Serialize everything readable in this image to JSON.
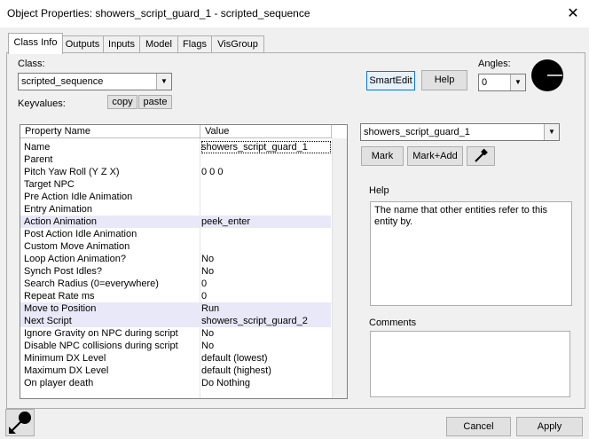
{
  "window": {
    "title": "Object Properties: showers_script_guard_1 - scripted_sequence",
    "close_glyph": "✕"
  },
  "tabs": [
    "Class Info",
    "Outputs",
    "Inputs",
    "Model",
    "Flags",
    "VisGroup"
  ],
  "class_section": {
    "class_label": "Class:",
    "class_value": "scripted_sequence",
    "keyvalues_label": "Keyvalues:",
    "copy_label": "copy",
    "paste_label": "paste",
    "smartedit_label": "SmartEdit",
    "help_label": "Help",
    "angles_label": "Angles:",
    "angles_value": "0"
  },
  "grid": {
    "columns": [
      "Property Name",
      "Value"
    ],
    "rows": [
      {
        "name": "Name",
        "value": "showers_script_guard_1"
      },
      {
        "name": "Parent",
        "value": ""
      },
      {
        "name": "Pitch Yaw Roll (Y Z X)",
        "value": "0 0 0"
      },
      {
        "name": "Target NPC",
        "value": ""
      },
      {
        "name": "Pre Action Idle Animation",
        "value": ""
      },
      {
        "name": "Entry Animation",
        "value": ""
      },
      {
        "name": "Action Animation",
        "value": "peek_enter"
      },
      {
        "name": "Post Action Idle Animation",
        "value": ""
      },
      {
        "name": "Custom Move Animation",
        "value": ""
      },
      {
        "name": "Loop Action Animation?",
        "value": "No"
      },
      {
        "name": "Synch Post Idles?",
        "value": "No"
      },
      {
        "name": "Search Radius (0=everywhere)",
        "value": "0"
      },
      {
        "name": "Repeat Rate ms",
        "value": "0"
      },
      {
        "name": "Move to Position",
        "value": "Run"
      },
      {
        "name": "Next Script",
        "value": "showers_script_guard_2"
      },
      {
        "name": "Ignore Gravity on NPC during script",
        "value": "No"
      },
      {
        "name": "Disable NPC collisions during script",
        "value": "No"
      },
      {
        "name": "Minimum DX Level",
        "value": "default (lowest)"
      },
      {
        "name": "Maximum DX Level",
        "value": "default (highest)"
      },
      {
        "name": "On player death",
        "value": "Do Nothing"
      }
    ]
  },
  "right_panel": {
    "name_value": "showers_script_guard_1",
    "mark_label": "Mark",
    "markadd_label": "Mark+Add",
    "help_title": "Help",
    "help_text": "The name that other entities refer to this entity by.",
    "comments_title": "Comments"
  },
  "footer": {
    "cancel_label": "Cancel",
    "apply_label": "Apply"
  },
  "icons": {
    "angle_dial": "angle-dial-icon",
    "picker": "eyedropper-icon",
    "pointer": "pointer-icon",
    "dropdown": "chevron-down-icon"
  }
}
